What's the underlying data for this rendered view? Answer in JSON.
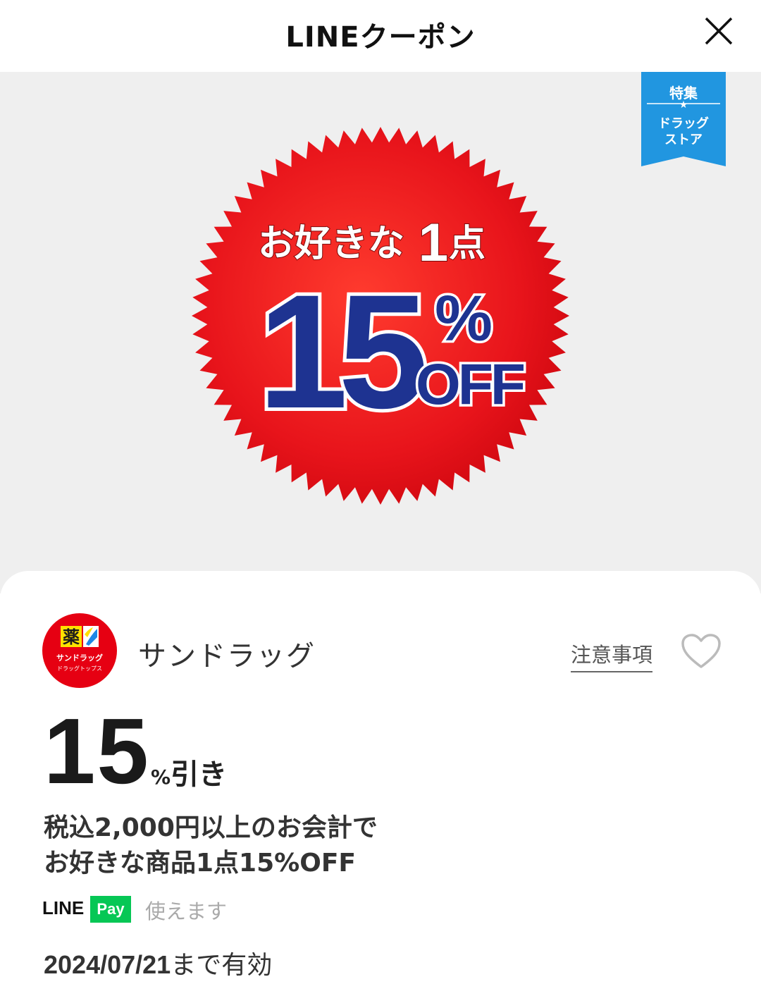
{
  "header": {
    "title": "LINEクーポン"
  },
  "banner": {
    "ribbon": {
      "top": "特集",
      "line1": "ドラッグ",
      "line2": "ストア"
    },
    "burst_line1": "お好きな",
    "burst_one": "1",
    "burst_point": "点",
    "burst_number": "15",
    "burst_percent": "%",
    "burst_off": "OFF",
    "colors": {
      "burst": "#e8141b",
      "number": "#1e3391",
      "ribbon": "#2196e0",
      "background": "#efefef"
    }
  },
  "store": {
    "logo": {
      "kanji": "薬",
      "line1": "サンドラッグ",
      "line2": "ドラッグトップス"
    },
    "name": "サンドラッグ",
    "notes_label": "注意事項"
  },
  "coupon": {
    "discount_value": "15",
    "discount_percent": "%",
    "discount_suffix": "引き",
    "description_line1": "税込2,000円以上のお会計で",
    "description_line2": "お好きな商品1点15%OFF",
    "pay": {
      "brand": "LINE",
      "badge": "Pay",
      "status": "使えます"
    },
    "valid_date": "2024/07/21",
    "valid_suffix": "まで有効"
  }
}
